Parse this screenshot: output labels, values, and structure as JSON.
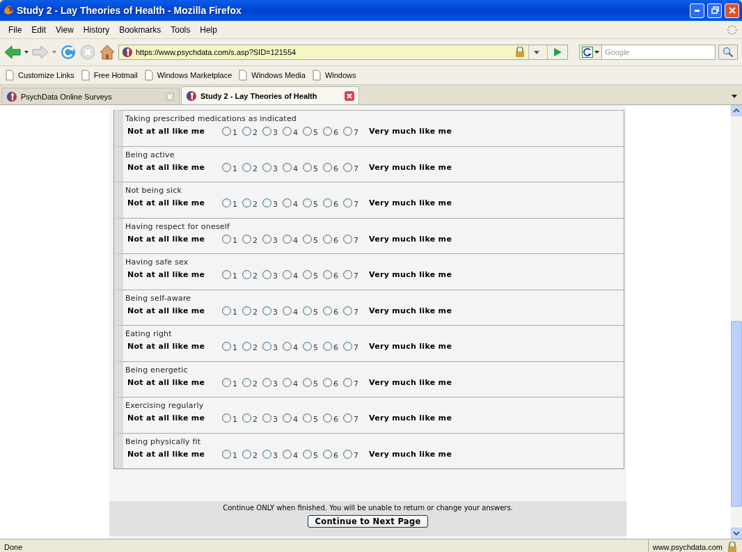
{
  "window": {
    "title": "Study 2 - Lay Theories of Health - Mozilla Firefox"
  },
  "menu": [
    "File",
    "Edit",
    "View",
    "History",
    "Bookmarks",
    "Tools",
    "Help"
  ],
  "address_bar": {
    "url": "https://www.psychdata.com/s.asp?SID=121554"
  },
  "search": {
    "placeholder": "Google"
  },
  "bookmarks": [
    "Customize Links",
    "Free Hotmail",
    "Windows Marketplace",
    "Windows Media",
    "Windows"
  ],
  "tabs": [
    {
      "label": "PsychData Online Surveys",
      "selected": false
    },
    {
      "label": "Study 2 - Lay Theories of Health",
      "selected": true
    }
  ],
  "survey": {
    "items": [
      {
        "label": "Taking prescribed medications as indicated",
        "left_anchor": "Not at all like me",
        "right_anchor": "Very much like me",
        "options": [
          {
            "value": "1",
            "selected": false
          },
          {
            "value": "2",
            "selected": false
          },
          {
            "value": "3",
            "selected": false
          },
          {
            "value": "4",
            "selected": false
          },
          {
            "value": "5",
            "selected": false
          },
          {
            "value": "6",
            "selected": false
          },
          {
            "value": "7",
            "selected": false
          }
        ]
      },
      {
        "label": "Being active",
        "left_anchor": "Not at all like me",
        "right_anchor": "Very much like me",
        "options": [
          {
            "value": "1",
            "selected": false
          },
          {
            "value": "2",
            "selected": false
          },
          {
            "value": "3",
            "selected": false
          },
          {
            "value": "4",
            "selected": false
          },
          {
            "value": "5",
            "selected": false
          },
          {
            "value": "6",
            "selected": false
          },
          {
            "value": "7",
            "selected": false
          }
        ]
      },
      {
        "label": "Not being sick",
        "left_anchor": "Not at all like me",
        "right_anchor": "Very much like me",
        "options": [
          {
            "value": "1",
            "selected": false
          },
          {
            "value": "2",
            "selected": false
          },
          {
            "value": "3",
            "selected": false
          },
          {
            "value": "4",
            "selected": false
          },
          {
            "value": "5",
            "selected": false
          },
          {
            "value": "6",
            "selected": false
          },
          {
            "value": "7",
            "selected": false
          }
        ]
      },
      {
        "label": "Having respect for oneself",
        "left_anchor": "Not at all like me",
        "right_anchor": "Very much like me",
        "options": [
          {
            "value": "1",
            "selected": false
          },
          {
            "value": "2",
            "selected": false
          },
          {
            "value": "3",
            "selected": false
          },
          {
            "value": "4",
            "selected": false
          },
          {
            "value": "5",
            "selected": false
          },
          {
            "value": "6",
            "selected": false
          },
          {
            "value": "7",
            "selected": false
          }
        ]
      },
      {
        "label": "Having safe sex",
        "left_anchor": "Not at all like me",
        "right_anchor": "Very much like me",
        "options": [
          {
            "value": "1",
            "selected": false
          },
          {
            "value": "2",
            "selected": false
          },
          {
            "value": "3",
            "selected": false
          },
          {
            "value": "4",
            "selected": false
          },
          {
            "value": "5",
            "selected": false
          },
          {
            "value": "6",
            "selected": false
          },
          {
            "value": "7",
            "selected": false
          }
        ]
      },
      {
        "label": "Being self-aware",
        "left_anchor": "Not at all like me",
        "right_anchor": "Very much like me",
        "options": [
          {
            "value": "1",
            "selected": false
          },
          {
            "value": "2",
            "selected": false
          },
          {
            "value": "3",
            "selected": false
          },
          {
            "value": "4",
            "selected": false
          },
          {
            "value": "5",
            "selected": false
          },
          {
            "value": "6",
            "selected": false
          },
          {
            "value": "7",
            "selected": false
          }
        ]
      },
      {
        "label": "Eating right",
        "left_anchor": "Not at all like me",
        "right_anchor": "Very much like me",
        "options": [
          {
            "value": "1",
            "selected": false
          },
          {
            "value": "2",
            "selected": false
          },
          {
            "value": "3",
            "selected": false
          },
          {
            "value": "4",
            "selected": false
          },
          {
            "value": "5",
            "selected": false
          },
          {
            "value": "6",
            "selected": false
          },
          {
            "value": "7",
            "selected": false
          }
        ]
      },
      {
        "label": "Being energetic",
        "left_anchor": "Not at all like me",
        "right_anchor": "Very much like me",
        "options": [
          {
            "value": "1",
            "selected": false
          },
          {
            "value": "2",
            "selected": false
          },
          {
            "value": "3",
            "selected": false
          },
          {
            "value": "4",
            "selected": false
          },
          {
            "value": "5",
            "selected": false
          },
          {
            "value": "6",
            "selected": false
          },
          {
            "value": "7",
            "selected": false
          }
        ]
      },
      {
        "label": "Exercising regularly",
        "left_anchor": "Not at all like me",
        "right_anchor": "Very much like me",
        "options": [
          {
            "value": "1",
            "selected": false
          },
          {
            "value": "2",
            "selected": false
          },
          {
            "value": "3",
            "selected": false
          },
          {
            "value": "4",
            "selected": false
          },
          {
            "value": "5",
            "selected": false
          },
          {
            "value": "6",
            "selected": false
          },
          {
            "value": "7",
            "selected": false
          }
        ]
      },
      {
        "label": "Being physically fit",
        "left_anchor": "Not at all like me",
        "right_anchor": "Very much like me",
        "options": [
          {
            "value": "1",
            "selected": false
          },
          {
            "value": "2",
            "selected": false
          },
          {
            "value": "3",
            "selected": false
          },
          {
            "value": "4",
            "selected": false
          },
          {
            "value": "5",
            "selected": false
          },
          {
            "value": "6",
            "selected": false
          },
          {
            "value": "7",
            "selected": false
          }
        ]
      }
    ],
    "notice": "Continue ONLY when finished. You will be unable to return or change your answers.",
    "continue_button": "Continue to Next Page"
  },
  "status_bar": {
    "text": "Done",
    "host": "www.psychdata.com"
  }
}
